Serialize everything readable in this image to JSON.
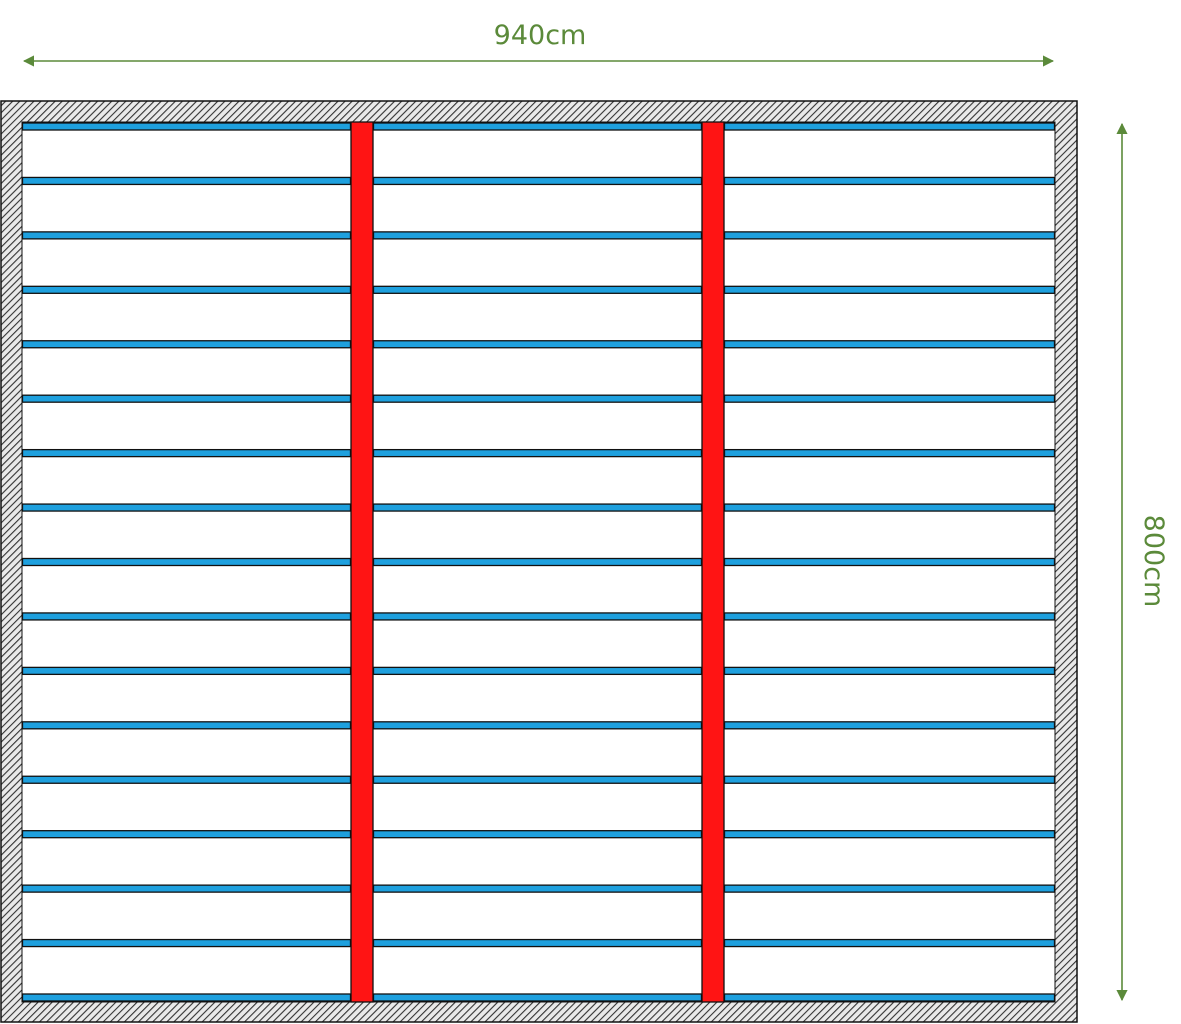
{
  "dimensions": {
    "width_label": "940cm",
    "height_label": "800cm"
  },
  "plan": {
    "joist_rows": 17,
    "joist_segments_per_row": 3,
    "beam_count": 2
  },
  "colors": {
    "dimension": "#5b8a3a",
    "joist_fill": "#1ea0de",
    "joist_stroke": "#111111",
    "beam_fill": "#ff1414",
    "beam_stroke": "#111111",
    "wall_hatch": "#333333",
    "wall_background": "#e9e9e9",
    "interior": "#ffffff"
  },
  "icons": {
    "arrow": "double-headed-arrow-icon",
    "wall": "hatched-wall"
  }
}
